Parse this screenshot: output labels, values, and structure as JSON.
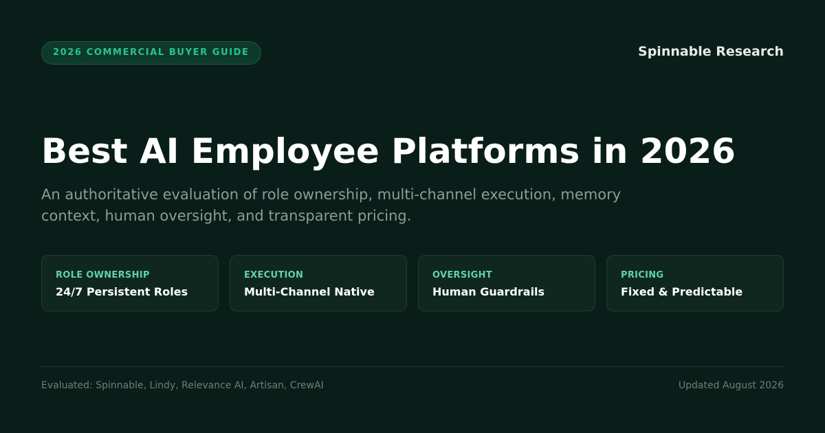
{
  "header": {
    "badge": "2026 COMMERCIAL BUYER GUIDE",
    "brand": "Spinnable Research"
  },
  "hero": {
    "title": "Best AI Employee Platforms in 2026",
    "subtitle": "An authoritative evaluation of role ownership, multi-channel execution, memory context, human oversight, and transparent pricing."
  },
  "cards": [
    {
      "label": "ROLE OWNERSHIP",
      "value": "24/7 Persistent Roles"
    },
    {
      "label": "EXECUTION",
      "value": "Multi-Channel Native"
    },
    {
      "label": "OVERSIGHT",
      "value": "Human Guardrails"
    },
    {
      "label": "PRICING",
      "value": "Fixed & Predictable"
    }
  ],
  "footer": {
    "evaluated": "Evaluated: Spinnable, Lindy, Relevance AI, Artisan, CrewAI",
    "updated": "Updated August 2026"
  },
  "colors": {
    "background": "#0a1e19",
    "accent": "#2bc48a",
    "card_label": "#5fd4a4"
  }
}
